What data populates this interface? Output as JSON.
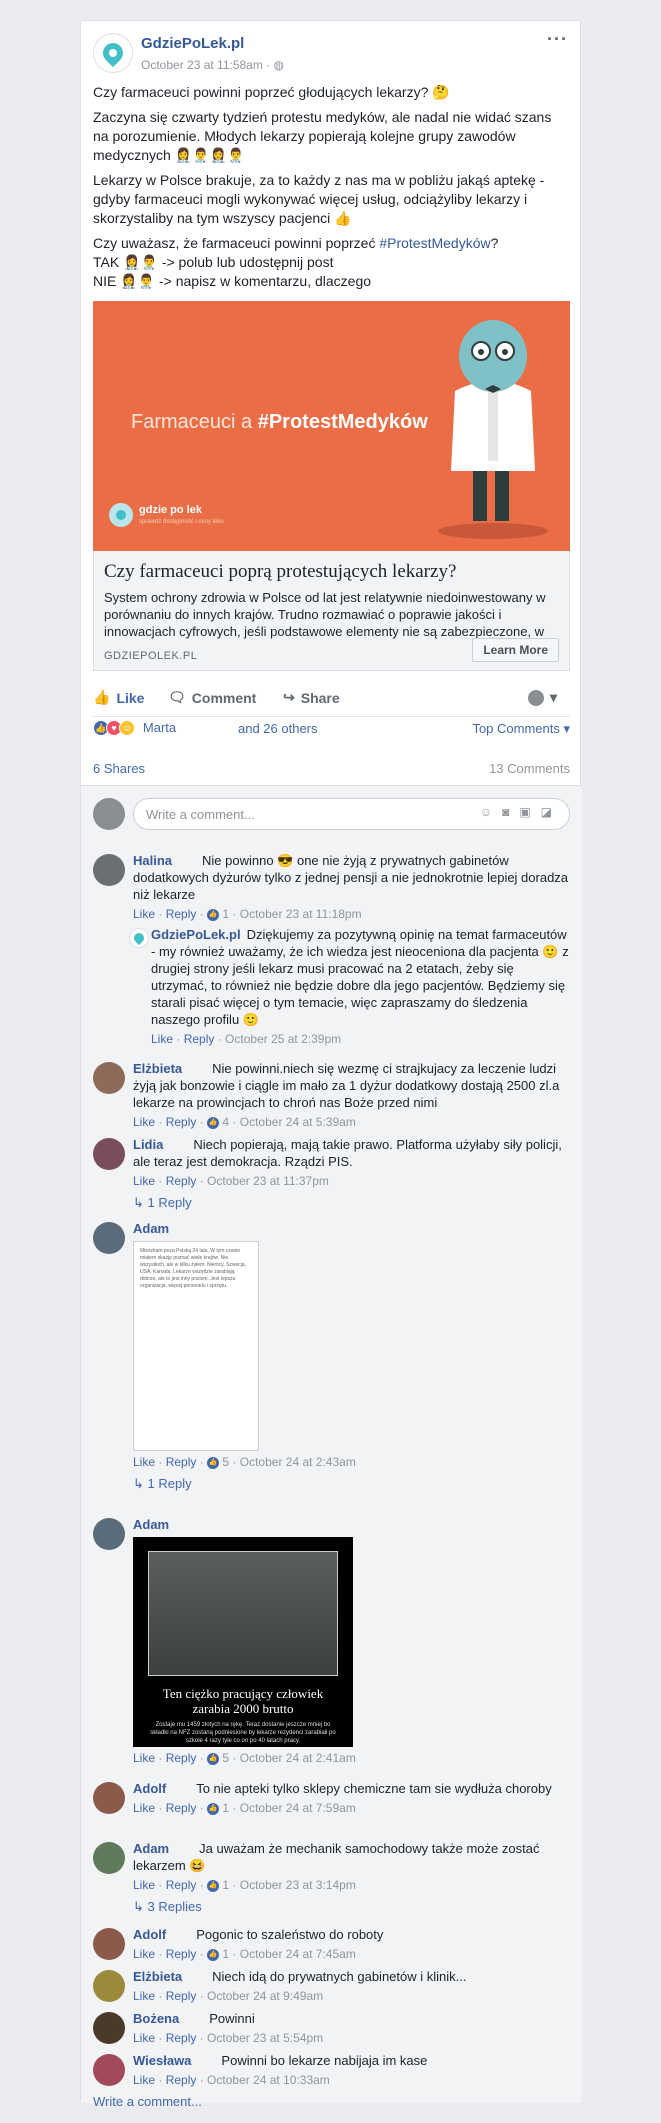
{
  "post": {
    "page_name": "GdziePoLek.pl",
    "time": "October 23 at 11:58am",
    "globe": "·",
    "paragraphs": [
      "Czy farmaceuci powinni poprzeć głodujących lekarzy? 🤔",
      "Zaczyna się czwarty tydzień protestu medyków, ale nadal nie widać szans na porozumienie. Młodych lekarzy popierają kolejne grupy zawodów medycznych 👩‍⚕️👨‍⚕️👩‍⚕️👨‍⚕️",
      "Lekarzy w Polsce brakuje, za to każdy z nas ma w pobliżu jakąś aptekę - gdyby farmaceuci mogli wykonywać więcej usług, odciążyliby lekarzy i skorzystaliby na tym wszyscy pacjenci 👍"
    ],
    "question_pre": "Czy uważasz, że farmaceuci powinni poprzeć ",
    "question_tag": "#ProtestMedyków",
    "question_post": "?",
    "tak": "TAK 👩‍⚕️👨‍⚕️ -> polub lub udostępnij post",
    "nie": "NIE 👩‍⚕️👨‍⚕️ -> napisz w komentarzu, dlaczego"
  },
  "link": {
    "image_title_plain": "Farmaceuci a ",
    "image_title_bold": "#ProtestMedyków",
    "image_brand": "gdzie po lek",
    "image_tagline": "sprawdź dostępność i ceny leku",
    "title": "Czy farmaceuci poprą protestujących lekarzy?",
    "desc": "System ochrony zdrowia w Polsce od lat jest relatywnie niedoinwestowany w porównaniu do innych krajów. Trudno rozmawiać o poprawie jakości i innowacjach cyfrowych, jeśli podstawowe elementy nie są zabezpieczone, w tym godne...",
    "domain": "GDZIEPOLEK.PL",
    "button": "Learn More"
  },
  "actions": {
    "like": "Like",
    "comment": "Comment",
    "share": "Share"
  },
  "reactions": {
    "names": "Marta",
    "others": "and 26 others",
    "sort": "Top Comments ▾"
  },
  "stats": {
    "shares": "6 Shares",
    "comments": "13 Comments"
  },
  "composer": {
    "placeholder": "Write a comment..."
  },
  "comments": [
    {
      "name": "Halina",
      "text": "Nie powinno 😎 one nie żyją z prywatnych gabinetów dodatkowych dyżurów tylko z jednej pensji a nie jednokrotnie lepiej doradza niż lekarze",
      "like": "Like",
      "reply": "Reply",
      "count": "1",
      "time": "October 23 at 11:18pm"
    },
    {
      "name": "GdziePoLek.pl",
      "text": "Dziękujemy za pozytywną opinię na temat farmaceutów - my również uważamy, że ich wiedza jest nieoceniona dla pacjenta 🙂 z drugiej strony jeśli lekarz musi pracować na 2 etatach, żeby się utrzymać, to również nie będzie dobre dla jego pacjentów. Będziemy się starali pisać więcej o tym temacie, więc zapraszamy do śledzenia naszego profilu 🙂",
      "like": "Like",
      "reply": "Reply",
      "time": "October 25 at 2:39pm"
    },
    {
      "name": "Elżbieta",
      "text": "Nie powinni.niech się wezmę ci strajkujacy za leczenie ludzi żyją jak bonzowie i ciągle im mało za 1 dyżur dodatkowy dostają 2500 zl.a lekarze na prowincjach to chroń nas Boże przed nimi",
      "like": "Like",
      "reply": "Reply",
      "count": "4",
      "time": "October 24 at 5:39am"
    },
    {
      "name": "Lidia",
      "text": "Niech popierają, mają takie prawo. Platforma użyłaby siły policji, ale teraz jest demokracja. Rządzi PIS.",
      "like": "Like",
      "reply": "Reply",
      "time": "October 23 at 11:37pm",
      "replies": "1 Reply"
    },
    {
      "name": "Adam",
      "like": "Like",
      "reply": "Reply",
      "count": "5",
      "time": "October 24 at 2:43am",
      "replies": "1 Reply",
      "doc_text": "Mieszkam poza Polską 24 lata. W tym czasie miałem okazję poznać wiele krajów. Nie wszystkich, ale w kilku żyłem: Niemcy, Szwecja, USA, Kanada. Lekarze wszędzie zarabiają dobrze, ale to jest inny poziom. Jest lepsza organizacja, więcej personelu i sprzętu."
    },
    {
      "name": "Adam",
      "like": "Like",
      "reply": "Reply",
      "count": "5",
      "time": "October 24 at 2:41am",
      "img_caption": "Ten ciężko pracujący człowiek zarabia 2000 brutto",
      "img_sub": "Zostaje mu 1459 złotych na rękę. Teraz dostanie jeszcze mniej bo składki na NFZ zostaną podniesione by lekarze rezydenci zarabiali po szkole 4 razy tyle co on po 40 latach pracy."
    },
    {
      "name": "Adolf",
      "text": "To nie apteki tylko sklepy chemiczne tam sie wydłuża choroby",
      "like": "Like",
      "reply": "Reply",
      "count": "1",
      "time": "October 24 at 7:59am"
    },
    {
      "name": "Adam",
      "text": "Ja uważam że mechanik samochodowy także może zostać lekarzem 😆",
      "like": "Like",
      "reply": "Reply",
      "count": "1",
      "time": "October 23 at 3:14pm",
      "replies": "3 Replies"
    },
    {
      "name": "Adolf",
      "text": "Pogonic to szaleństwo do roboty",
      "like": "Like",
      "reply": "Reply",
      "count": "1",
      "time": "October 24 at 7:45am"
    },
    {
      "name": "Elżbieta",
      "text": "Niech idą do prywatnych gabinetów i klinik...",
      "like": "Like",
      "reply": "Reply",
      "time": "October 24 at 9:49am"
    },
    {
      "name": "Bożena",
      "text": "Powinni",
      "like": "Like",
      "reply": "Reply",
      "time": "October 23 at 5:54pm"
    },
    {
      "name": "Wiesława",
      "text": "Powinni bo lekarze nabijaja im kase",
      "like": "Like",
      "reply": "Reply",
      "time": "October 24 at 10:33am"
    }
  ],
  "write_comment": "Write a comment..."
}
